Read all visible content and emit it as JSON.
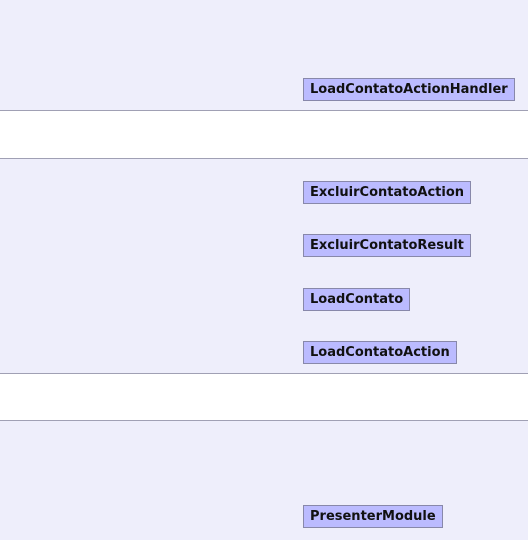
{
  "colors": {
    "band": "#eeeefb",
    "node_fill": "#bbbbff",
    "node_border": "#8888aa",
    "separator": "#a0a0b4"
  },
  "groups": [
    {
      "nodes": [
        "LoadContatoActionHandler"
      ]
    },
    {
      "nodes": [
        "ExcluirContatoAction",
        "ExcluirContatoResult",
        "LoadContato",
        "LoadContatoAction"
      ]
    },
    {
      "nodes": [
        "PresenterModule"
      ]
    }
  ]
}
